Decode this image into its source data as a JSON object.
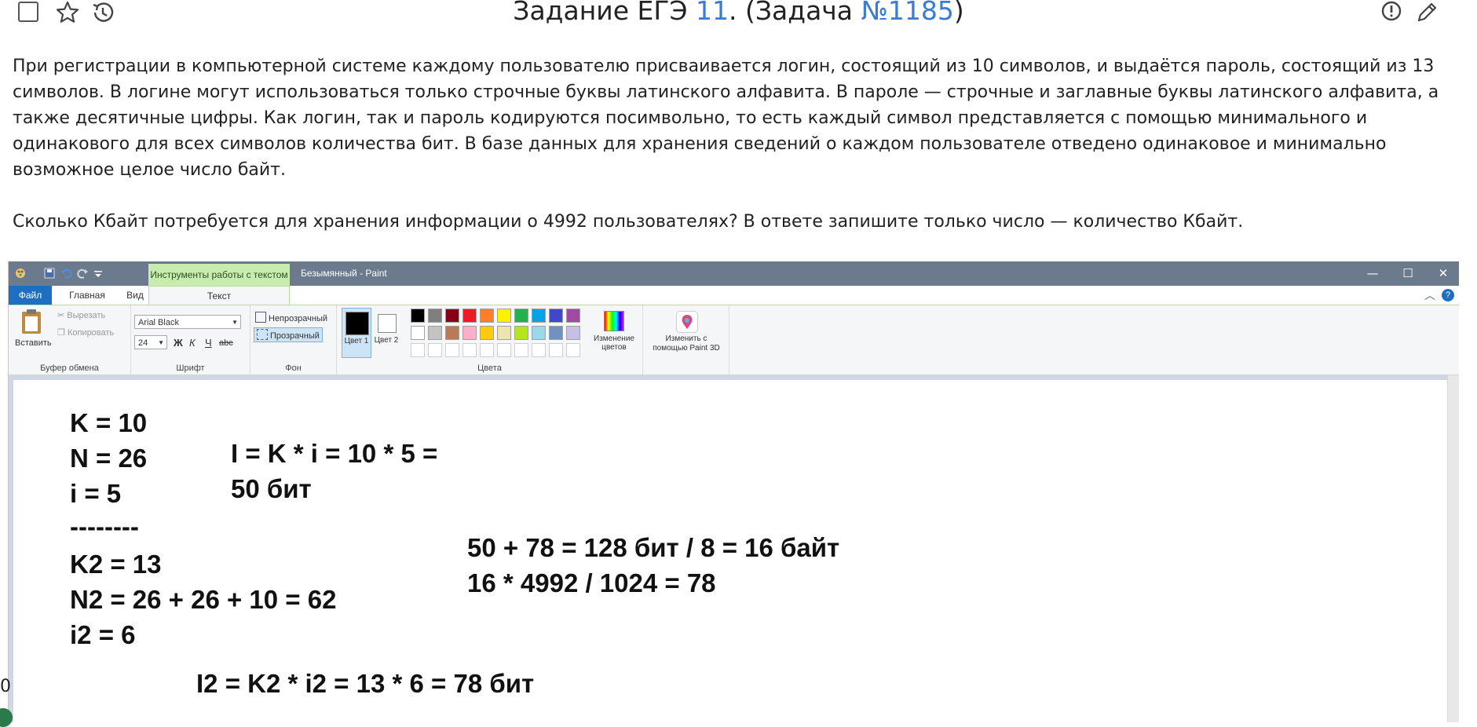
{
  "header": {
    "title_prefix": "Задание ЕГЭ ",
    "task_number": "11",
    "title_middle": ". (Задача ",
    "problem_id": "№1185",
    "title_suffix": ")",
    "icons": [
      "checkbox-icon",
      "star-icon",
      "history-icon",
      "report-icon",
      "edit-icon"
    ]
  },
  "task": {
    "paragraph1": "При регистрации в компьютерной системе каждому пользователю присваивается логин, состоящий из 10 символов, и выдаётся пароль, состоящий из 13 символов. В логине могут использоваться только строчные буквы латинского алфавита. В пароле — строчные и заглавные буквы латинского алфавита, а также десятичные цифры. Как логин, так и пароль кодируются посимвольно, то есть каждый символ представляется с помощью минимального и одинакового для всех символов количества бит. В базе данных для хранения сведений о каждом пользователе отведено одинаковое и минимально возможное целое число байт.",
    "paragraph2": "Сколько Кбайт потребуется для хранения информации о 4992 пользователях? В ответе запишите только число — количество Кбайт."
  },
  "paint": {
    "context_tab": "Инструменты работы с текстом",
    "window_title": "Безымянный - Paint",
    "window_controls": [
      "—",
      "☐",
      "✕"
    ],
    "tabs": {
      "file": "Файл",
      "home": "Главная",
      "view": "Вид",
      "text": "Текст"
    },
    "clipboard": {
      "paste": "Вставить",
      "cut": "Вырезать",
      "copy": "Копировать",
      "label": "Буфер обмена"
    },
    "font": {
      "family": "Arial Black",
      "size": "24",
      "bold": "Ж",
      "italic": "К",
      "underline": "Ч",
      "strike": "abc",
      "label": "Шрифт"
    },
    "background": {
      "opaque": "Непрозрачный",
      "transparent": "Прозрачный",
      "label": "Фон"
    },
    "colors": {
      "color1": "Цвет 1",
      "color2": "Цвет 2",
      "edit": "Изменение цветов",
      "label": "Цвета",
      "palette_row1": [
        "#000000",
        "#7f7f7f",
        "#880015",
        "#ed1c24",
        "#ff7f27",
        "#fff200",
        "#22b14c",
        "#00a2e8",
        "#3f48cc",
        "#a349a4"
      ],
      "palette_row2": [
        "#ffffff",
        "#c3c3c3",
        "#b97a57",
        "#ffaec9",
        "#ffc90e",
        "#efe4b0",
        "#b5e61d",
        "#99d9ea",
        "#7092be",
        "#c8bfe7"
      ]
    },
    "paint3d": "Изменить с помощью Paint 3D",
    "canvas_lines": {
      "k": "K  = 10",
      "n": "N = 26",
      "i": "i = 5",
      "sep": "--------",
      "k2": "K2 = 13",
      "n2": "N2 = 26 + 26 + 10 = 62",
      "i2": "i2 = 6",
      "login_calc1": "I = K * i = 10 * 5 =",
      "login_calc2": "50 бит",
      "total_calc": "50 + 78 = 128 бит / 8 = 16 байт",
      "kb_calc": "16 * 4992 / 1024 = 78",
      "pass_calc": "I2 = K2 * i2 = 13 * 6 = 78 бит"
    }
  },
  "fragment": "0"
}
